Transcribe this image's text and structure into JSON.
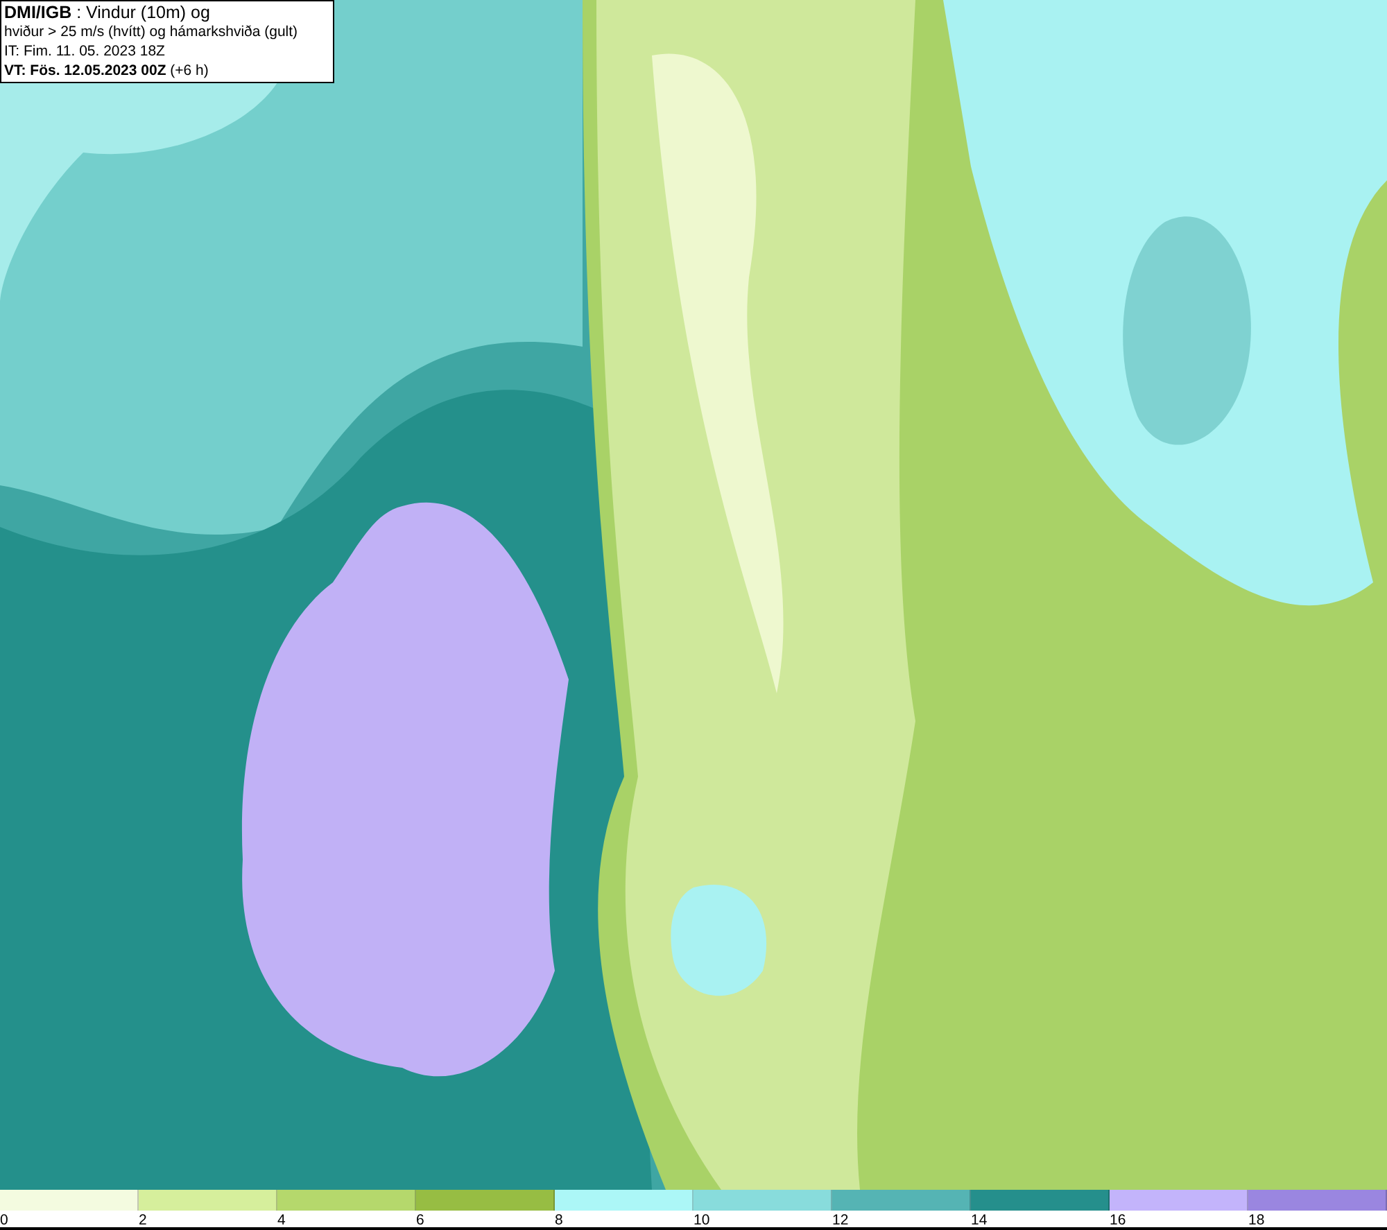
{
  "title_box": {
    "lines": [
      "**DMI/IGB** : Vindur (10m) og",
      "hviður > 25 m/s (hvítt) og hámarkshviða (gult)",
      "IT: Fim. 11. 05. 2023 18Z",
      "**VT: Fös. 12.05.2023 00Z** (+6 h)"
    ]
  },
  "legend": {
    "segments": [
      {
        "color": "#f4fbe0"
      },
      {
        "color": "#d6ef9c"
      },
      {
        "color": "#b5d86c"
      },
      {
        "color": "#97bd43"
      },
      {
        "color": "#acf7f7"
      },
      {
        "color": "#88dcdc"
      },
      {
        "color": "#55b4b4"
      },
      {
        "color": "#258f8c"
      },
      {
        "color": "#c3b4fb"
      },
      {
        "color": "#9a86e0"
      }
    ],
    "ticks": [
      "0",
      "2",
      "4",
      "6",
      "8",
      "10",
      "12",
      "14",
      "16",
      "18"
    ]
  }
}
